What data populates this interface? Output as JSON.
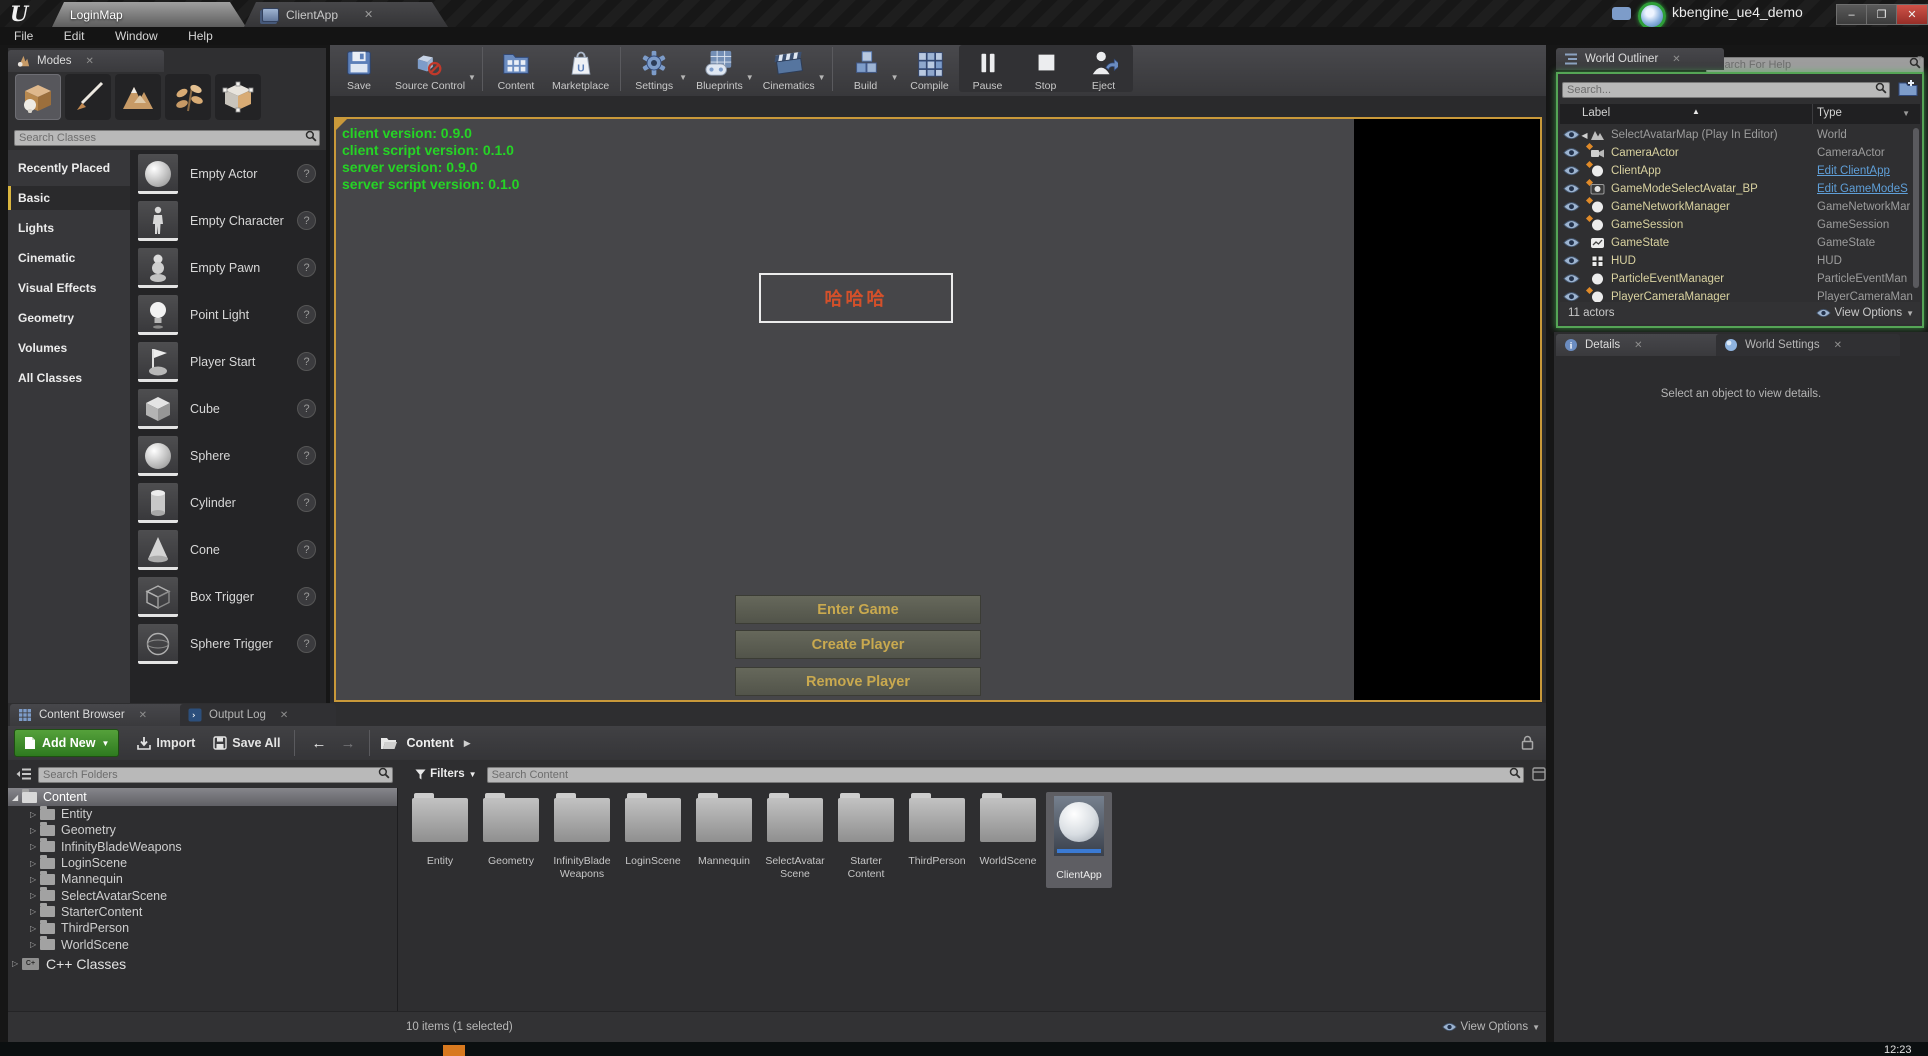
{
  "window": {
    "tabs": [
      {
        "label": "LoginMap"
      },
      {
        "label": "ClientApp"
      }
    ],
    "project_title": "kbengine_ue4_demo",
    "menu": [
      "File",
      "Edit",
      "Window",
      "Help"
    ],
    "help_search_placeholder": "Search For Help",
    "minimize": "–",
    "restore": "❐",
    "close": "✕"
  },
  "toolbar": {
    "items": [
      "Save",
      "Source Control",
      "Content",
      "Marketplace",
      "Settings",
      "Blueprints",
      "Cinematics",
      "Build",
      "Compile",
      "Pause",
      "Stop",
      "Eject"
    ]
  },
  "modes": {
    "tab_label": "Modes",
    "search_placeholder": "Search Classes",
    "categories": [
      "Recently Placed",
      "Basic",
      "Lights",
      "Cinematic",
      "Visual Effects",
      "Geometry",
      "Volumes",
      "All Classes"
    ],
    "selected_category": "Basic",
    "items": [
      "Empty Actor",
      "Empty Character",
      "Empty Pawn",
      "Point Light",
      "Player Start",
      "Cube",
      "Sphere",
      "Cylinder",
      "Cone",
      "Box Trigger",
      "Sphere Trigger"
    ]
  },
  "viewport": {
    "hud": [
      "client version: 0.9.0",
      "client script version: 0.1.0",
      "server version: 0.9.0",
      "server script version: 0.1.0"
    ],
    "dialog_text": "哈哈哈",
    "buttons": [
      "Enter Game",
      "Create Player",
      "Remove Player"
    ],
    "colors": {
      "hud_green": "#25d425",
      "border_orange": "#c9993a",
      "dialog_text": "#d4502a",
      "button_text": "#c9a94f"
    }
  },
  "outliner": {
    "tab_label": "World Outliner",
    "search_placeholder": "Search...",
    "columns": [
      "Label",
      "Type"
    ],
    "rows": [
      {
        "label": "SelectAvatarMap (Play In Editor)",
        "type": "World"
      },
      {
        "label": "CameraActor",
        "type": "CameraActor"
      },
      {
        "label": "ClientApp",
        "type": "Edit ClientApp"
      },
      {
        "label": "GameModeSelectAvatar_BP",
        "type": "Edit GameModeS"
      },
      {
        "label": "GameNetworkManager",
        "type": "GameNetworkMar"
      },
      {
        "label": "GameSession",
        "type": "GameSession"
      },
      {
        "label": "GameState",
        "type": "GameState"
      },
      {
        "label": "HUD",
        "type": "HUD"
      },
      {
        "label": "ParticleEventManager",
        "type": "ParticleEventMan"
      },
      {
        "label": "PlayerCameraManager",
        "type": "PlayerCameraMan"
      }
    ],
    "status": "11 actors",
    "view_options": "View Options",
    "pie_border_green": "#55a556"
  },
  "details": {
    "tabs": [
      "Details",
      "World Settings"
    ],
    "empty_message": "Select an object to view details."
  },
  "content_browser": {
    "tabs": [
      "Content Browser",
      "Output Log"
    ],
    "add_new": "Add New",
    "import": "Import",
    "save_all": "Save All",
    "breadcrumb": "Content",
    "search_folders_placeholder": "Search Folders",
    "filters_label": "Filters",
    "search_content_placeholder": "Search Content",
    "tree": [
      "Content",
      "Entity",
      "Geometry",
      "InfinityBladeWeapons",
      "LoginScene",
      "Mannequin",
      "SelectAvatarScene",
      "StarterContent",
      "ThirdPerson",
      "WorldScene",
      "C++ Classes"
    ],
    "assets": [
      {
        "label": "Entity",
        "kind": "folder"
      },
      {
        "label": "Geometry",
        "kind": "folder"
      },
      {
        "label": "InfinityBlade Weapons",
        "kind": "folder"
      },
      {
        "label": "LoginScene",
        "kind": "folder"
      },
      {
        "label": "Mannequin",
        "kind": "folder"
      },
      {
        "label": "SelectAvatar Scene",
        "kind": "folder"
      },
      {
        "label": "Starter Content",
        "kind": "folder"
      },
      {
        "label": "ThirdPerson",
        "kind": "folder"
      },
      {
        "label": "WorldScene",
        "kind": "folder"
      },
      {
        "label": "ClientApp",
        "kind": "blueprint",
        "selected": true
      }
    ],
    "status": "10 items (1 selected)",
    "view_options": "View Options"
  },
  "taskbar": {
    "clock": "12:23"
  }
}
